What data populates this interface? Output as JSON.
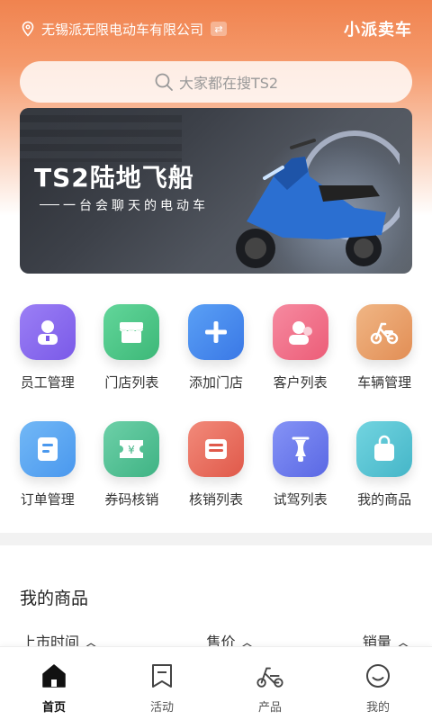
{
  "header": {
    "location": "无锡派无限电动车有限公司",
    "brand": "小派卖车"
  },
  "search": {
    "placeholder": "大家都在搜TS2"
  },
  "banner": {
    "title": "TS2陆地飞船",
    "subtitle": "一台会聊天的电动车"
  },
  "grid": {
    "items": [
      {
        "label": "员工管理",
        "icon": "employee-icon",
        "color": "#8e6ff0"
      },
      {
        "label": "门店列表",
        "icon": "store-icon",
        "color": "#4fc98a"
      },
      {
        "label": "添加门店",
        "icon": "plus-icon",
        "color": "#4a8cf0"
      },
      {
        "label": "客户列表",
        "icon": "customer-icon",
        "color": "#f0728a"
      },
      {
        "label": "车辆管理",
        "icon": "scooter-icon",
        "color": "#e8a46c"
      },
      {
        "label": "订单管理",
        "icon": "order-icon",
        "color": "#5aaaf0"
      },
      {
        "label": "券码核销",
        "icon": "coupon-icon",
        "color": "#56c09a"
      },
      {
        "label": "核销列表",
        "icon": "verify-list-icon",
        "color": "#ea7564"
      },
      {
        "label": "试驾列表",
        "icon": "test-drive-icon",
        "color": "#6e7ef0"
      },
      {
        "label": "我的商品",
        "icon": "shopping-bag-icon",
        "color": "#5cc6d6"
      }
    ]
  },
  "products": {
    "title": "我的商品",
    "sort": {
      "time": "上市时间",
      "price": "售价",
      "sales": "销量"
    }
  },
  "tabbar": {
    "items": [
      {
        "label": "首页",
        "icon": "home-icon"
      },
      {
        "label": "活动",
        "icon": "bookmark-icon"
      },
      {
        "label": "产品",
        "icon": "scooter-icon"
      },
      {
        "label": "我的",
        "icon": "smile-icon"
      }
    ]
  }
}
